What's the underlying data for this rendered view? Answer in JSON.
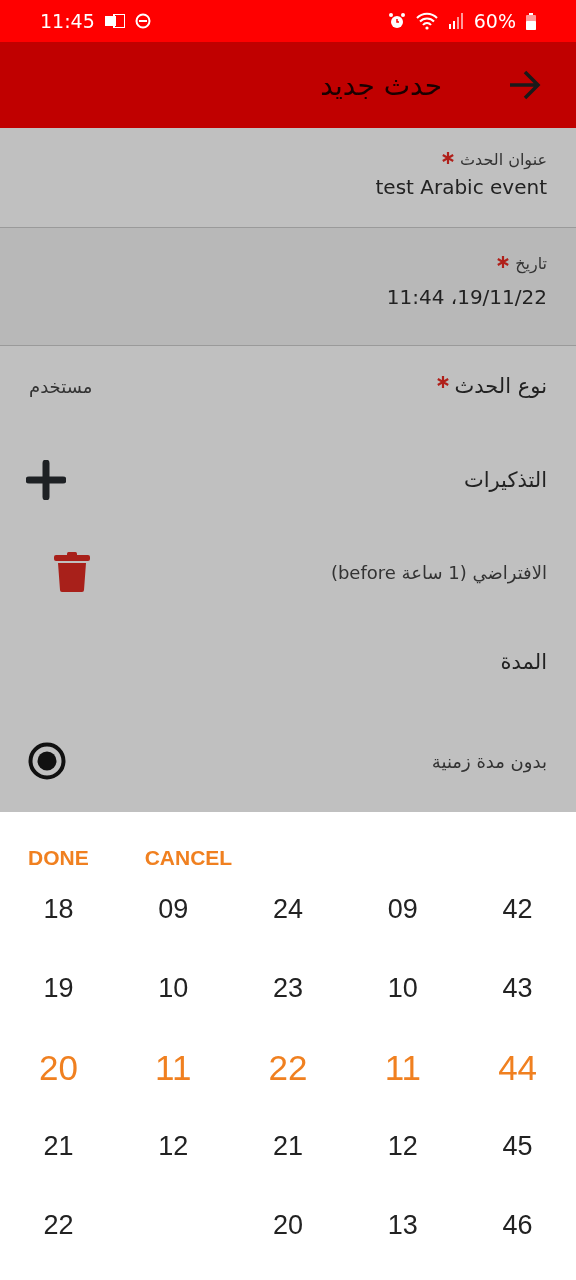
{
  "status_bar": {
    "time": "11:45",
    "battery": "60%"
  },
  "app_bar": {
    "title": "حدث جديد"
  },
  "fields": [
    {
      "label": "عنوان الحدث",
      "required": true,
      "value": "test Arabic event"
    },
    {
      "label": "تاريخ",
      "required": true,
      "value": "19/11/22، 11:44"
    }
  ],
  "rows": [
    {
      "kind": "select",
      "label": "نوع الحدث",
      "required": true,
      "value": "مستخدم"
    },
    {
      "kind": "add",
      "label": "التذكيرات"
    },
    {
      "kind": "reminder",
      "label": "الافتراضي (1 ساعة before)"
    },
    {
      "kind": "heading",
      "label": "المدة"
    },
    {
      "kind": "radio",
      "label": "بدون مدة زمنية",
      "selected": true
    }
  ],
  "picker": {
    "buttons": [
      "CANCEL",
      "DONE"
    ],
    "columns": [
      {
        "values": [
          {
            "text": "42",
            "selected": false
          },
          {
            "text": "43",
            "selected": false
          },
          {
            "text": "44",
            "selected": true
          },
          {
            "text": "45",
            "selected": false
          },
          {
            "text": "46",
            "selected": false
          }
        ]
      },
      {
        "values": [
          {
            "text": "09",
            "selected": false
          },
          {
            "text": "10",
            "selected": false
          },
          {
            "text": "11",
            "selected": true
          },
          {
            "text": "12",
            "selected": false
          },
          {
            "text": "13",
            "selected": false
          }
        ]
      },
      {
        "values": [
          {
            "text": "24",
            "selected": false
          },
          {
            "text": "23",
            "selected": false
          },
          {
            "text": "22",
            "selected": true
          },
          {
            "text": "21",
            "selected": false
          },
          {
            "text": "20",
            "selected": false
          }
        ]
      },
      {
        "values": [
          {
            "text": "09",
            "selected": false
          },
          {
            "text": "10",
            "selected": false
          },
          {
            "text": "11",
            "selected": true
          },
          {
            "text": "12",
            "selected": false
          }
        ]
      },
      {
        "values": [
          {
            "text": "18",
            "selected": false
          },
          {
            "text": "19",
            "selected": false
          },
          {
            "text": "20",
            "selected": true
          },
          {
            "text": "21",
            "selected": false
          },
          {
            "text": "22",
            "selected": false
          }
        ]
      }
    ]
  }
}
